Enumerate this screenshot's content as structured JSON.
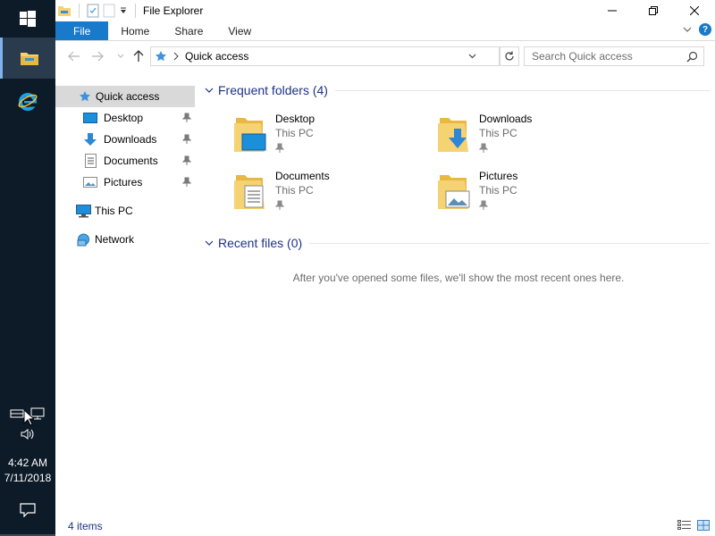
{
  "window": {
    "title": "File Explorer",
    "ribbon_tabs": [
      "File",
      "Home",
      "Share",
      "View"
    ]
  },
  "address": {
    "path": "Quick access",
    "search_placeholder": "Search Quick access"
  },
  "navpane": {
    "items": [
      {
        "label": "Quick access",
        "icon": "star-icon",
        "selected": true
      },
      {
        "label": "Desktop",
        "icon": "desktop-icon",
        "pinned": true
      },
      {
        "label": "Downloads",
        "icon": "download-icon",
        "pinned": true
      },
      {
        "label": "Documents",
        "icon": "documents-icon",
        "pinned": true
      },
      {
        "label": "Pictures",
        "icon": "pictures-icon",
        "pinned": true
      },
      {
        "label": "This PC",
        "icon": "computer-icon"
      },
      {
        "label": "Network",
        "icon": "network-icon"
      }
    ]
  },
  "content": {
    "frequent_header": "Frequent folders (4)",
    "recent_header": "Recent files (0)",
    "empty_message": "After you've opened some files, we'll show the most recent ones here.",
    "folders": [
      {
        "name": "Desktop",
        "location": "This PC"
      },
      {
        "name": "Downloads",
        "location": "This PC"
      },
      {
        "name": "Documents",
        "location": "This PC"
      },
      {
        "name": "Pictures",
        "location": "This PC"
      }
    ]
  },
  "status": {
    "item_count": "4 items"
  },
  "taskbar": {
    "time": "4:42 AM",
    "date": "7/11/2018"
  },
  "colors": {
    "accent": "#1979ca",
    "taskbar": "#0d1a27",
    "header_text": "#1e3287",
    "folder_yellow": "#f5d272"
  }
}
